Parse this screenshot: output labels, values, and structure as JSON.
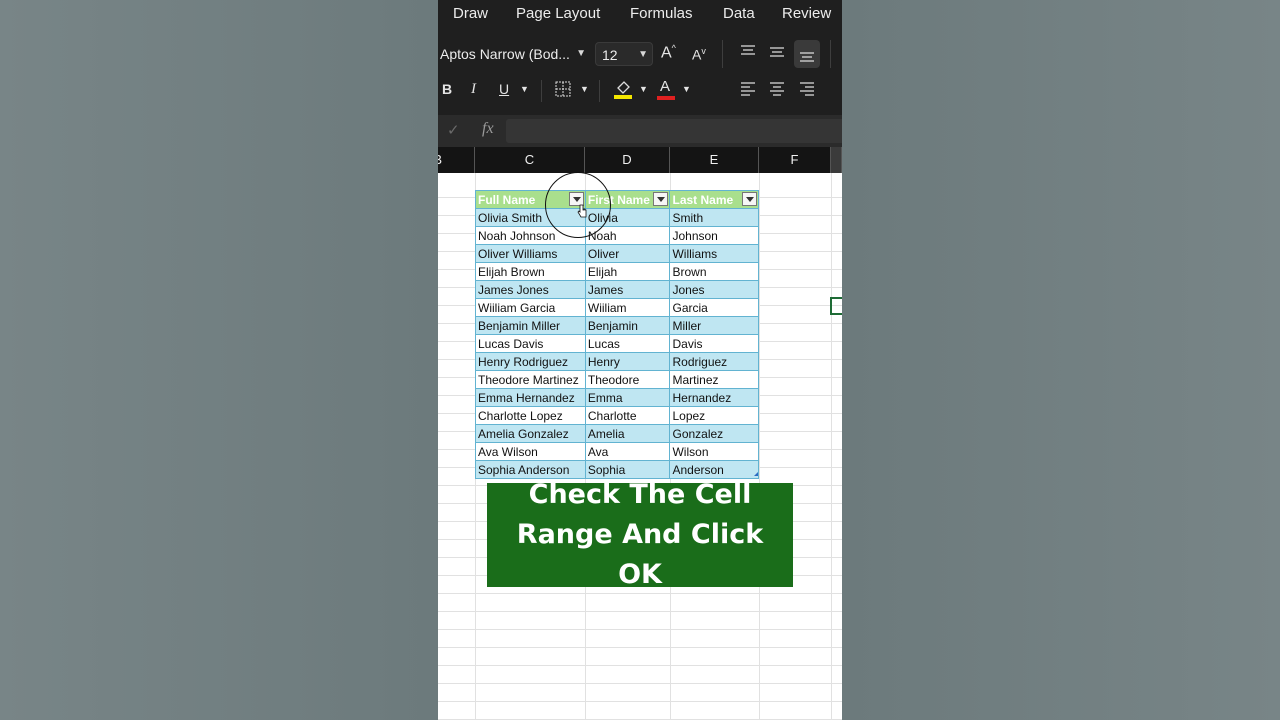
{
  "ribbon_tabs": [
    "Draw",
    "Page Layout",
    "Formulas",
    "Data",
    "Review"
  ],
  "font": {
    "name": "Aptos Narrow (Bod...",
    "size": "12"
  },
  "format_buttons": {
    "bold": "B",
    "italic": "I",
    "underline": "U",
    "grow": "A",
    "shrink": "A",
    "font_color": "A"
  },
  "formula_bar": {
    "fx": "fx",
    "check": "✓",
    "value": ""
  },
  "columns": [
    "B",
    "C",
    "D",
    "E",
    "F"
  ],
  "table": {
    "headers": [
      "Full Name",
      "First Name",
      "Last Name"
    ],
    "rows": [
      [
        "Olivia Smith",
        "Olivia",
        "Smith"
      ],
      [
        "Noah Johnson",
        "Noah",
        "Johnson"
      ],
      [
        "Oliver Williams",
        "Oliver",
        "Williams"
      ],
      [
        "Elijah Brown",
        "Elijah",
        "Brown"
      ],
      [
        "James Jones",
        "James",
        "Jones"
      ],
      [
        "Wiiliam Garcia",
        "Wiiliam",
        "Garcia"
      ],
      [
        "Benjamin Miller",
        "Benjamin",
        "Miller"
      ],
      [
        "Lucas Davis",
        "Lucas",
        "Davis"
      ],
      [
        "Henry Rodriguez",
        "Henry",
        "Rodriguez"
      ],
      [
        "Theodore Martinez",
        "Theodore",
        "Martinez"
      ],
      [
        "Emma Hernandez",
        "Emma",
        "Hernandez"
      ],
      [
        "Charlotte Lopez",
        "Charlotte",
        "Lopez"
      ],
      [
        "Amelia Gonzalez",
        "Amelia",
        "Gonzalez"
      ],
      [
        "Ava Wilson",
        "Ava",
        "Wilson"
      ],
      [
        "Sophia Anderson",
        "Sophia",
        "Anderson"
      ]
    ]
  },
  "callout": "Check The Cell Range And Click OK",
  "colors": {
    "ribbon": "#1f1f1f",
    "table_header": "#a9df8d",
    "table_band": "#bfe6f2",
    "callout": "#1a6d1a",
    "highlight_swatch": "#f3e600",
    "font_color_swatch": "#e02020"
  }
}
